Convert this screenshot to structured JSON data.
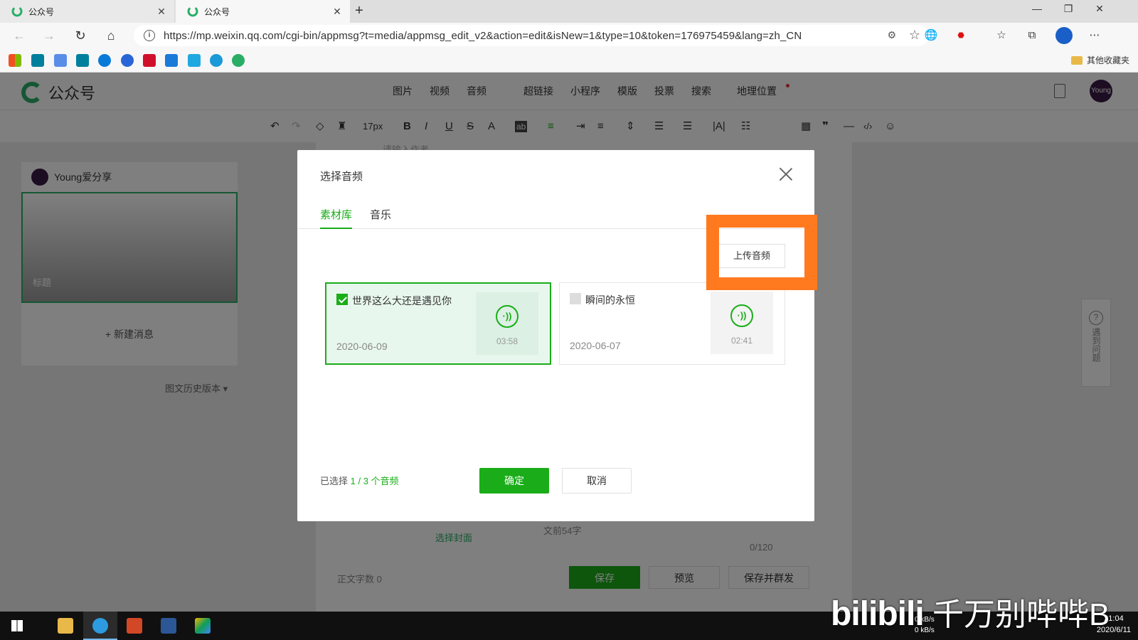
{
  "browser": {
    "tabs": [
      {
        "title": "公众号",
        "active": false
      },
      {
        "title": "公众号",
        "active": true
      }
    ],
    "url": "https://mp.weixin.qq.com/cgi-bin/appmsg?t=media/appmsg_edit_v2&action=edit&isNew=1&type=10&token=176975459&lang=zh_CN",
    "bookmarks_other": "其他收藏夹"
  },
  "header": {
    "logo_text": "公众号",
    "insert_menu": [
      "图片",
      "视频",
      "音频",
      "超链接",
      "小程序",
      "模版",
      "投票",
      "搜索",
      "地理位置"
    ],
    "avatar_text": "Young"
  },
  "toolbar": {
    "font_size": "17px"
  },
  "left": {
    "account_name": "Young爱分享",
    "cover_title": "标题",
    "new_message": "+ 新建消息",
    "history": "图文历史版本 ▾"
  },
  "editor": {
    "author_placeholder": "请输入作者",
    "choose_cover": "选择封面",
    "digest_placeholder": "文前54字",
    "digest_count": "0/120",
    "word_count": "正文字数  0",
    "save": "保存",
    "preview": "预览",
    "save_send": "保存并群发"
  },
  "help": {
    "label": "遇到问题"
  },
  "dialog": {
    "title": "选择音频",
    "tabs": [
      "素材库",
      "音乐"
    ],
    "upload": "上传音频",
    "items": [
      {
        "name": "世界这么大还是遇见你",
        "date": "2020-06-09",
        "duration": "03:58",
        "selected": true
      },
      {
        "name": "瞬间的永恒",
        "date": "2020-06-07",
        "duration": "02:41",
        "selected": false
      }
    ],
    "selected_prefix": "已选择 ",
    "selected_count": "1 / 3",
    "selected_suffix": " 个音频",
    "ok": "确定",
    "cancel": "取消"
  },
  "taskbar": {
    "date": "2020/6/11",
    "time": "21:04",
    "net_up": "0 kB/s",
    "net_down": "0 kB/s"
  },
  "watermark": {
    "brand": "bilibili",
    "text": "千万别哔哔B"
  }
}
